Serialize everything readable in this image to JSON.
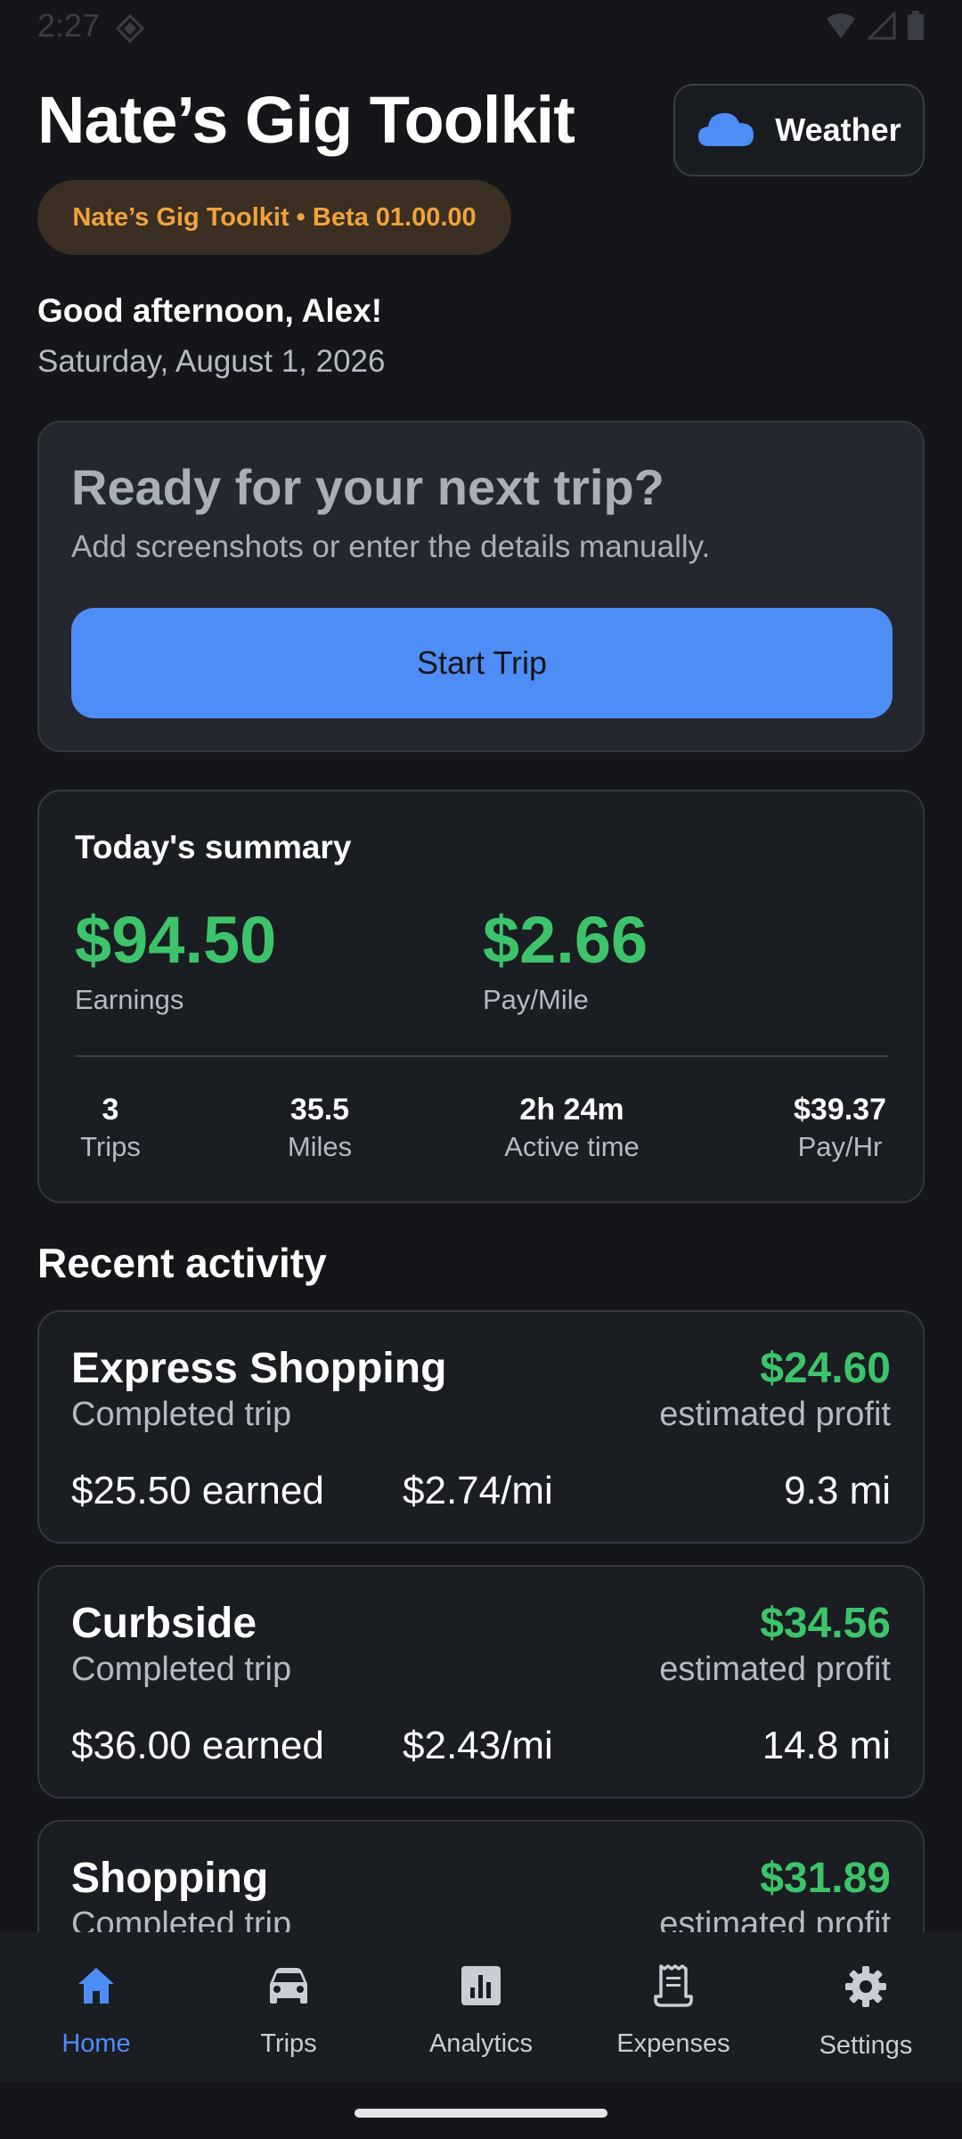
{
  "status_bar": {
    "time": "2:27"
  },
  "header": {
    "title": "Nate’s Gig Toolkit",
    "weather_label": "Weather",
    "beta_label": "Nate’s Gig Toolkit • Beta 01.00.00",
    "greeting": "Good afternoon, Alex!",
    "date": "Saturday, August 1, 2026"
  },
  "ready_card": {
    "title": "Ready for your next trip?",
    "subtitle": "Add screenshots or enter the details manually.",
    "button_label": "Start Trip"
  },
  "summary": {
    "title": "Today's summary",
    "earnings_value": "$94.50",
    "earnings_label": "Earnings",
    "pay_mile_value": "$2.66",
    "pay_mile_label": "Pay/Mile",
    "stats": [
      {
        "value": "3",
        "label": "Trips"
      },
      {
        "value": "35.5",
        "label": "Miles"
      },
      {
        "value": "2h 24m",
        "label": "Active time"
      },
      {
        "value": "$39.37",
        "label": "Pay/Hr"
      }
    ]
  },
  "recent": {
    "title": "Recent activity",
    "items": [
      {
        "name": "Express Shopping",
        "status": "Completed trip",
        "profit": "$24.60",
        "profit_label": "estimated profit",
        "earned": "$25.50 earned",
        "rate": "$2.74/mi",
        "miles": "9.3 mi"
      },
      {
        "name": "Curbside",
        "status": "Completed trip",
        "profit": "$34.56",
        "profit_label": "estimated profit",
        "earned": "$36.00 earned",
        "rate": "$2.43/mi",
        "miles": "14.8 mi"
      },
      {
        "name": "Shopping",
        "status": "Completed trip",
        "profit": "$31.89",
        "profit_label": "estimated profit",
        "earned": "",
        "rate": "",
        "miles": ""
      }
    ]
  },
  "nav": {
    "items": [
      {
        "label": "Home",
        "icon": "home-icon",
        "active": true
      },
      {
        "label": "Trips",
        "icon": "car-icon"
      },
      {
        "label": "Analytics",
        "icon": "analytics-icon"
      },
      {
        "label": "Expenses",
        "icon": "receipt-icon"
      },
      {
        "label": "Settings",
        "icon": "gear-icon"
      }
    ]
  },
  "colors": {
    "accent": "#4e8df5",
    "profit_green": "#3dc46b",
    "beta_orange": "#f2a33a",
    "background": "#14161a"
  }
}
